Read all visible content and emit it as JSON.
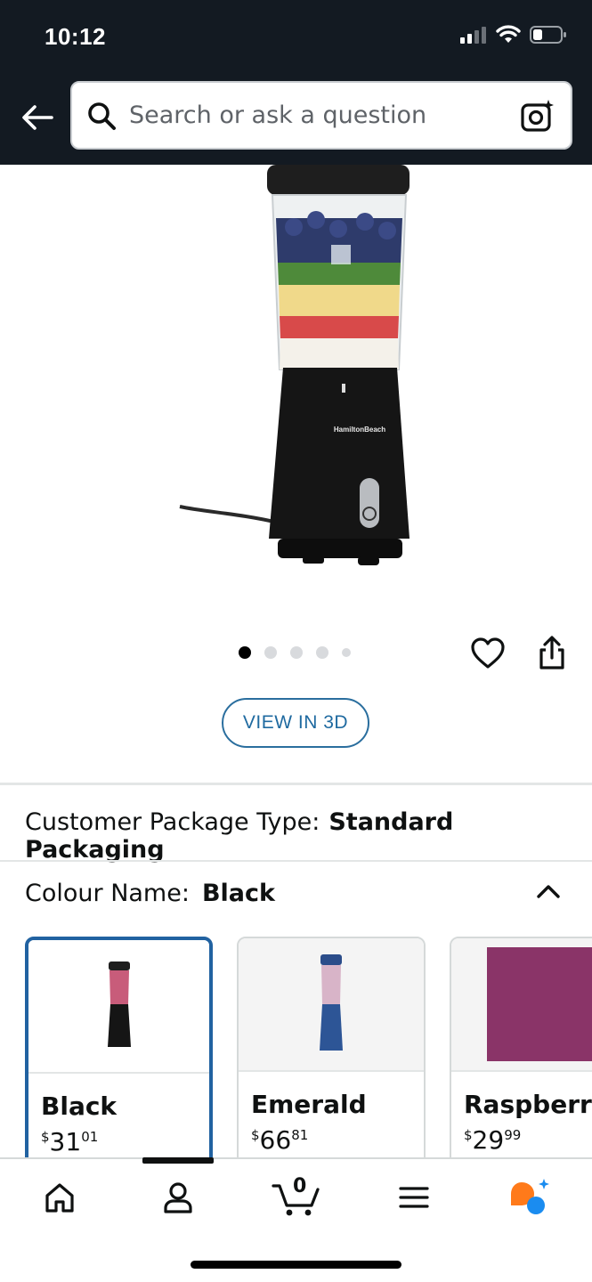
{
  "status_bar": {
    "time": "10:12"
  },
  "header": {
    "search": {
      "placeholder": "Search or ask a question"
    }
  },
  "product": {
    "brand_mark": "HamiltonBeach",
    "carousel": {
      "total": 5,
      "active_index": 0
    }
  },
  "actions": {
    "view_3d_label": "VIEW IN 3D"
  },
  "package": {
    "label": "Customer Package Type:",
    "value": "Standard Packaging"
  },
  "colour": {
    "label": "Colour Name:",
    "value": "Black",
    "options": [
      {
        "name": "Black",
        "price_symbol": "$",
        "price_whole": "31",
        "price_fraction": "01",
        "selected": true
      },
      {
        "name": "Emerald",
        "price_symbol": "$",
        "price_whole": "66",
        "price_fraction": "81",
        "selected": false
      },
      {
        "name": "Raspberry",
        "price_symbol": "$",
        "price_whole": "29",
        "price_fraction": "99",
        "selected": false,
        "swatch_color": "#8a3468"
      }
    ]
  },
  "bottom_nav": {
    "items": [
      "home-icon",
      "account-icon",
      "cart-icon",
      "menu-icon",
      "rufus-icon"
    ],
    "cart_count": "0"
  },
  "colors": {
    "header_bg": "#131a22",
    "accent_blue": "#2162a1",
    "rufus_orange": "#ff7a1a",
    "rufus_blue": "#1a8cf0"
  }
}
